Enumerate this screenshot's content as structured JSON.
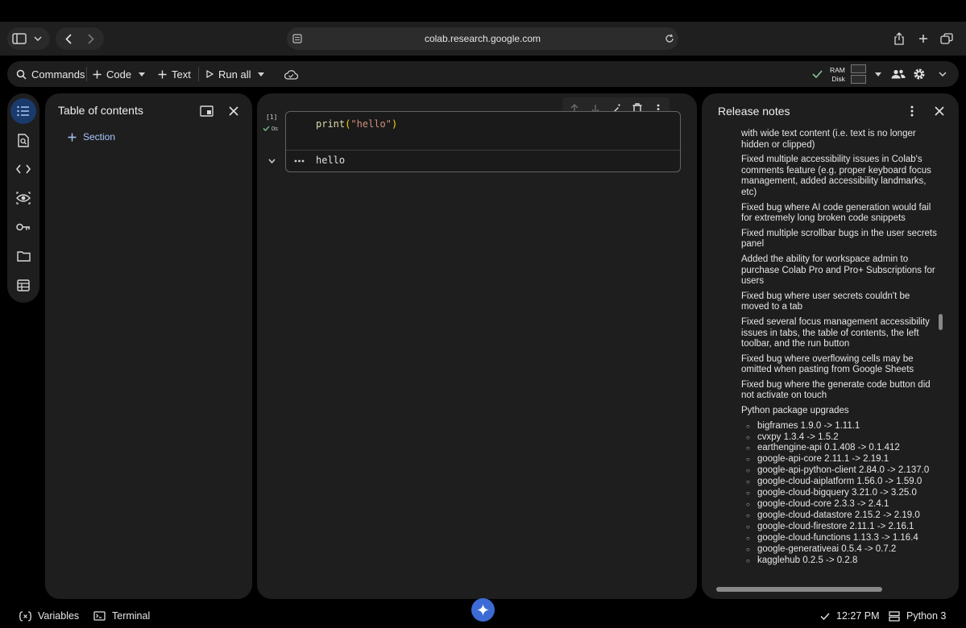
{
  "browser": {
    "url": "colab.research.google.com"
  },
  "toolbar": {
    "commands_label": "Commands",
    "code_label": "Code",
    "text_label": "Text",
    "run_all_label": "Run all",
    "ram_label": "RAM",
    "disk_label": "Disk"
  },
  "toc": {
    "title": "Table of contents",
    "section_label": "Section"
  },
  "cell": {
    "exec_count": "[1]",
    "exec_time": "0s",
    "code_fn": "print",
    "code_open": "(",
    "code_str": "\"hello\"",
    "code_close": ")",
    "output": "hello"
  },
  "release_notes": {
    "title": "Release notes",
    "items": [
      "with wide text content (i.e. text is no longer hidden or clipped)",
      "Fixed multiple accessibility issues in Colab's comments feature (e.g. proper keyboard focus management, added accessibility landmarks, etc)",
      "Fixed bug where AI code generation would fail for extremely long broken code snippets",
      "Fixed multiple scrollbar bugs in the user secrets panel",
      "Added the ability for workspace admin to purchase Colab Pro and Pro+ Subscriptions for users",
      "Fixed bug where user secrets couldn't be moved to a tab",
      "Fixed several focus management accessibility issues in tabs, the table of contents, the left toolbar, and the run button",
      "Fixed bug where overflowing cells may be omitted when pasting from Google Sheets",
      "Fixed bug where the generate code button did not activate on touch",
      "Python package upgrades"
    ],
    "packages": [
      "bigframes 1.9.0 -> 1.11.1",
      "cvxpy 1.3.4 -> 1.5.2",
      "earthengine-api 0.1.408 -> 0.1.412",
      "google-api-core 2.11.1 -> 2.19.1",
      "google-api-python-client 2.84.0 -> 2.137.0",
      "google-cloud-aiplatform 1.56.0 -> 1.59.0",
      "google-cloud-bigquery 3.21.0 -> 3.25.0",
      "google-cloud-core 2.3.3 -> 2.4.1",
      "google-cloud-datastore 2.15.2 -> 2.19.0",
      "google-cloud-firestore 2.11.1 -> 2.16.1",
      "google-cloud-functions 1.13.3 -> 1.16.4",
      "google-generativeai 0.5.4 -> 0.7.2",
      "kagglehub 0.2.5 -> 0.2.8"
    ]
  },
  "status": {
    "variables_label": "Variables",
    "terminal_label": "Terminal",
    "time": "12:27 PM",
    "runtime": "Python 3"
  },
  "colors": {
    "accent": "#a8c7fa",
    "panel_bg": "#1e1e1e",
    "ok_green": "#81c995",
    "gemini_blue": "#3d6bd6"
  }
}
